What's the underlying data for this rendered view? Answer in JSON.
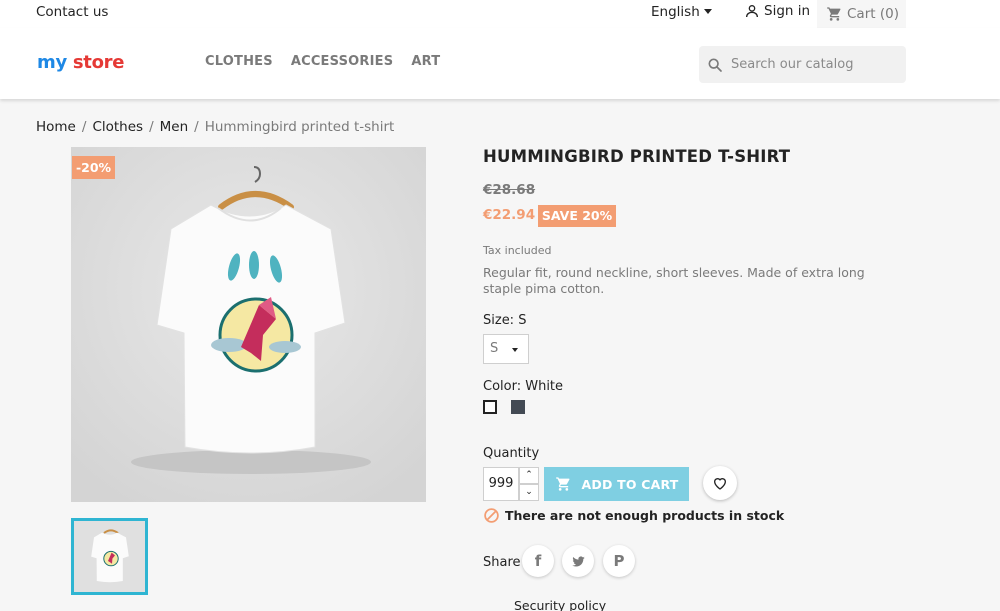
{
  "topbar": {
    "contact": "Contact us",
    "language": "English",
    "signin": "Sign in",
    "cart": "Cart (0)"
  },
  "header": {
    "logo": {
      "my": "my",
      "store": "store"
    },
    "nav": [
      "CLOTHES",
      "ACCESSORIES",
      "ART"
    ],
    "search_placeholder": "Search our catalog"
  },
  "breadcrumb": {
    "items": [
      "Home",
      "Clothes",
      "Men"
    ],
    "current": "Hummingbird printed t-shirt"
  },
  "product": {
    "discount_flag": "-20%",
    "title": "HUMMINGBIRD PRINTED T-SHIRT",
    "old_price": "€28.68",
    "price": "€22.94",
    "save_badge": "SAVE 20%",
    "tax": "Tax included",
    "description": "Regular fit, round neckline, short sleeves. Made of extra long staple pima cotton.",
    "size_label": "Size: S",
    "size_value": "S",
    "color_label": "Color: White",
    "colors": [
      "#ffffff",
      "#434a54"
    ],
    "quantity_label": "Quantity",
    "quantity_value": "999",
    "add_to_cart": "ADD TO CART",
    "stock_message": "There are not enough products in stock",
    "share_label": "Share",
    "security": "Security policy"
  },
  "colors": {
    "accent": "#2fb5d2",
    "add_to_cart_bg": "#7fcfe2",
    "discount": "#f39d72"
  }
}
